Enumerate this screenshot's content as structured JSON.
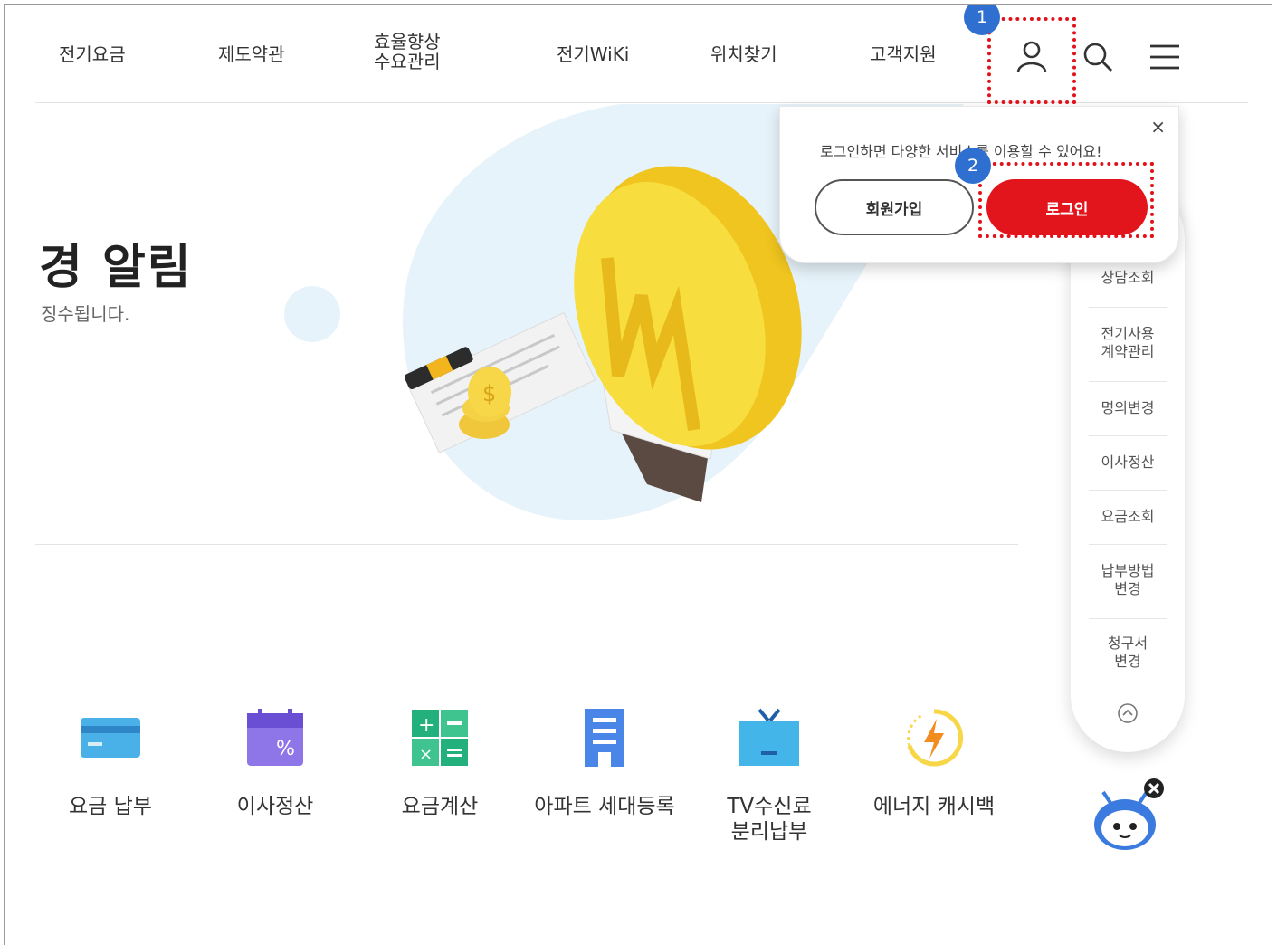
{
  "nav": {
    "items": [
      "전기요금",
      "제도약관",
      "효율향상\n수요관리",
      "전기WiKi",
      "위치찾기",
      "고객지원"
    ],
    "icons": [
      "user-icon",
      "search-icon",
      "menu-icon"
    ]
  },
  "callouts": {
    "step1": "1",
    "step2": "2"
  },
  "hero": {
    "title": "경 알림",
    "subtitle": "징수됩니다."
  },
  "login_popup": {
    "message": "로그인하면 다양한 서비스를 이용할 수 있어요!",
    "close": "×",
    "join_label": "회원가입",
    "login_label": "로그인"
  },
  "sidebar": {
    "items": [
      "상담조회",
      "전기사용\n계약관리",
      "명의변경",
      "이사정산",
      "요금조회",
      "납부방법\n변경",
      "청구서\n변경"
    ]
  },
  "quick_menu": [
    {
      "label": "요금 납부",
      "icon": "credit-card-icon"
    },
    {
      "label": "이사정산",
      "icon": "calendar-icon"
    },
    {
      "label": "요금계산",
      "icon": "calculator-icon"
    },
    {
      "label": "아파트 세대등록",
      "icon": "apartment-icon"
    },
    {
      "label": "TV수신료\n분리납부",
      "icon": "tv-icon"
    },
    {
      "label": "에너지 캐시백",
      "icon": "energy-cashback-icon"
    }
  ],
  "colors": {
    "accent_red": "#e3151c",
    "badge_blue": "#2f6fd0",
    "bulb_yellow": "#f6d83a"
  }
}
